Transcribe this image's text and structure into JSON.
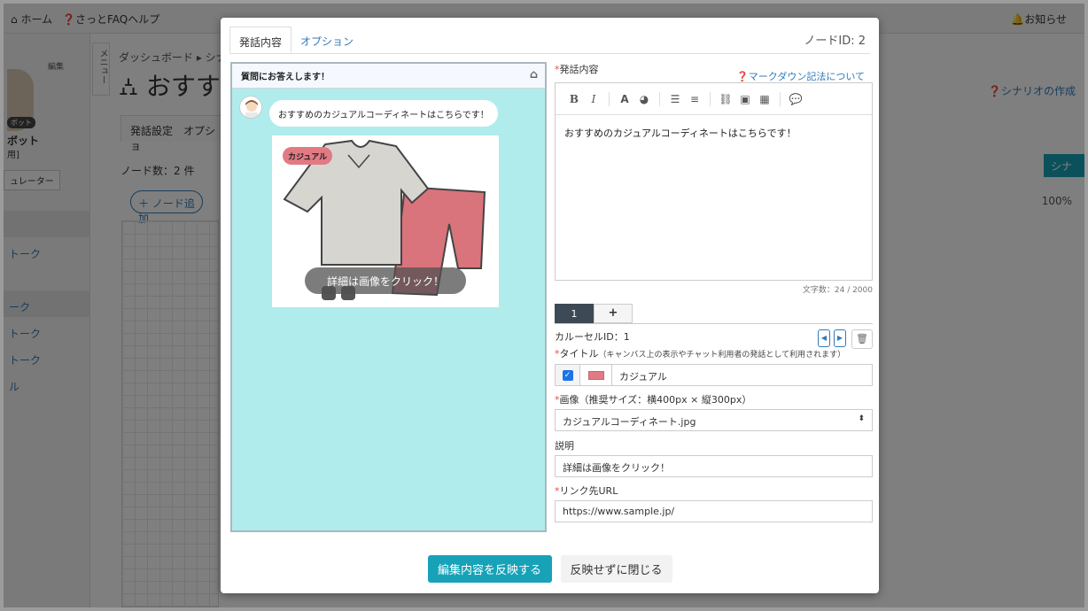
{
  "background": {
    "topbar": {
      "home": "ホーム",
      "help": "さっとFAQヘルプ",
      "notice": "お知らせ"
    },
    "sidebar": {
      "edit_link": "編集",
      "bot_badge": "ボット",
      "bot_name": "ボット",
      "bot_sub": "用]",
      "simulator": "ュレーター",
      "items": [
        "トーク",
        "ーク",
        "トーク",
        "トーク",
        "ル"
      ]
    },
    "menu_tab": "メニュー",
    "breadcrumb": "ダッシュボード ▸ シナリ",
    "page_title": "おすす",
    "tabs": [
      "発話設定",
      "オプショ"
    ],
    "node_count": "ノード数：2 件",
    "add_node": "ノード追加",
    "scenario_help": "シナリオの作成",
    "scenario_btn": "シナリ",
    "zoom": "100%"
  },
  "modal": {
    "tabs": [
      "発話内容",
      "オプション"
    ],
    "node_id": "ノードID: 2",
    "preview": {
      "header": "質問にお答えします！",
      "message": "おすすめのカジュアルコーディネートはこちらです！",
      "card_badge": "カジュアル",
      "card_caption": "詳細は画像をクリック！"
    },
    "form": {
      "speech_label": "発話内容",
      "markdown_link": "マークダウン記法について",
      "editor_text": "おすすめのカジュアルコーディネートはこちらです！",
      "char_count": "文字数：24 / 2000",
      "carousel_tabs": [
        "1",
        "+"
      ],
      "carousel_id": "カルーセルID：1",
      "title_label": "タイトル",
      "title_note": "（キャンバス上の表示やチャット利用者の発話として利用されます）",
      "title_value": "カジュアル",
      "title_color": "#e27a84",
      "image_label": "画像（推奨サイズ：横400px × 縦300px）",
      "image_value": "カジュアルコーディネート.jpg",
      "desc_label": "説明",
      "desc_value": "詳細は画像をクリック！",
      "url_label": "リンク先URL",
      "url_value": "https://www.sample.jp/"
    },
    "buttons": {
      "apply": "編集内容を反映する",
      "close": "反映せずに閉じる"
    }
  }
}
